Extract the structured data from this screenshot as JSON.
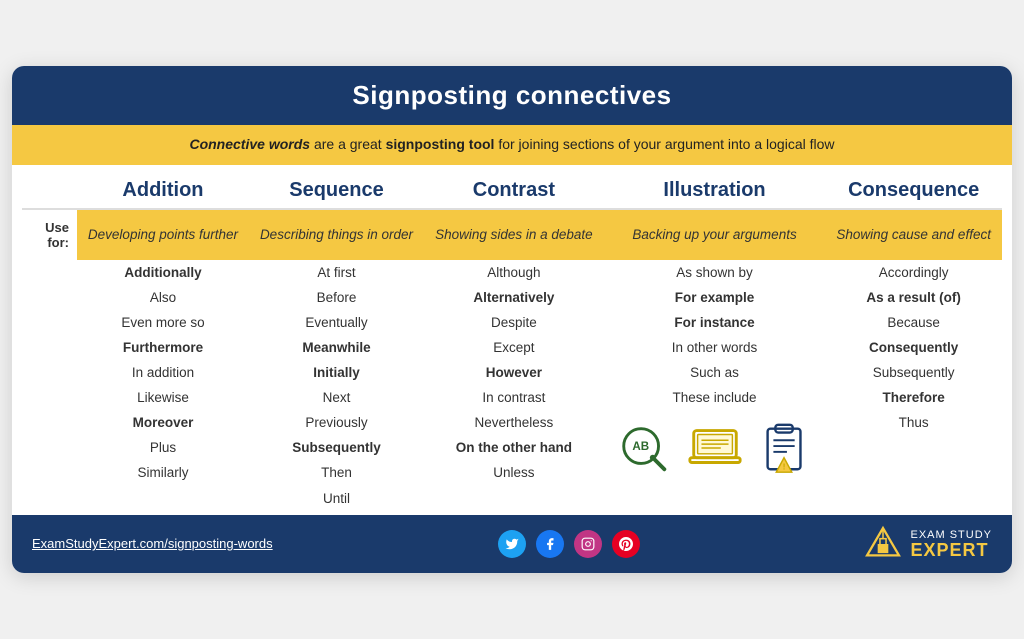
{
  "title": "Signposting connectives",
  "subtitle": {
    "full": "Connective words are a great signposting tool for joining sections of your argument into a logical flow"
  },
  "columns": [
    {
      "id": "addition",
      "label": "Addition",
      "use_for": "Developing points further"
    },
    {
      "id": "sequence",
      "label": "Sequence",
      "use_for": "Describing things in order"
    },
    {
      "id": "contrast",
      "label": "Contrast",
      "use_for": "Showing sides in a debate"
    },
    {
      "id": "illustration",
      "label": "Illustration",
      "use_for": "Backing up your arguments"
    },
    {
      "id": "consequence",
      "label": "Consequence",
      "use_for": "Showing cause and effect"
    }
  ],
  "use_for_label": "Use for:",
  "rows": [
    [
      {
        "text": "Additionally",
        "bold": true
      },
      {
        "text": "At first",
        "bold": false
      },
      {
        "text": "Although",
        "bold": false
      },
      {
        "text": "As shown by",
        "bold": false
      },
      {
        "text": "Accordingly",
        "bold": false
      }
    ],
    [
      {
        "text": "Also",
        "bold": false
      },
      {
        "text": "Before",
        "bold": false
      },
      {
        "text": "Alternatively",
        "bold": true
      },
      {
        "text": "For example",
        "bold": true
      },
      {
        "text": "As a result (of)",
        "bold": true
      }
    ],
    [
      {
        "text": "Even more so",
        "bold": false
      },
      {
        "text": "Eventually",
        "bold": false
      },
      {
        "text": "Despite",
        "bold": false
      },
      {
        "text": "For instance",
        "bold": true
      },
      {
        "text": "Because",
        "bold": false
      }
    ],
    [
      {
        "text": "Furthermore",
        "bold": true
      },
      {
        "text": "Meanwhile",
        "bold": true
      },
      {
        "text": "Except",
        "bold": false
      },
      {
        "text": "In other words",
        "bold": false
      },
      {
        "text": "Consequently",
        "bold": true
      }
    ],
    [
      {
        "text": "In addition",
        "bold": false
      },
      {
        "text": "Initially",
        "bold": true
      },
      {
        "text": "However",
        "bold": true
      },
      {
        "text": "Such as",
        "bold": false
      },
      {
        "text": "Subsequently",
        "bold": false
      }
    ],
    [
      {
        "text": "Likewise",
        "bold": false
      },
      {
        "text": "Next",
        "bold": false
      },
      {
        "text": "In contrast",
        "bold": false
      },
      {
        "text": "These include",
        "bold": false
      },
      {
        "text": "Therefore",
        "bold": true
      }
    ],
    [
      {
        "text": "Moreover",
        "bold": true
      },
      {
        "text": "Previously",
        "bold": false
      },
      {
        "text": "Nevertheless",
        "bold": false
      },
      {
        "text": "illustration_icons",
        "bold": false
      },
      {
        "text": "Thus",
        "bold": false
      }
    ],
    [
      {
        "text": "Plus",
        "bold": false
      },
      {
        "text": "Subsequently",
        "bold": true
      },
      {
        "text": "On the other hand",
        "bold": true
      },
      {
        "text": "",
        "bold": false
      },
      {
        "text": "",
        "bold": false
      }
    ],
    [
      {
        "text": "Similarly",
        "bold": false
      },
      {
        "text": "Then",
        "bold": false
      },
      {
        "text": "Unless",
        "bold": false
      },
      {
        "text": "",
        "bold": false
      },
      {
        "text": "",
        "bold": false
      }
    ],
    [
      {
        "text": "",
        "bold": false
      },
      {
        "text": "Until",
        "bold": false
      },
      {
        "text": "",
        "bold": false
      },
      {
        "text": "",
        "bold": false
      },
      {
        "text": "",
        "bold": false
      }
    ]
  ],
  "footer": {
    "url": "ExamStudyExpert.com/signposting-words",
    "brand_top": "EXAM STUDY",
    "brand_bottom": "EXPERT",
    "social": [
      "Twitter",
      "Facebook",
      "Instagram",
      "Pinterest"
    ]
  }
}
